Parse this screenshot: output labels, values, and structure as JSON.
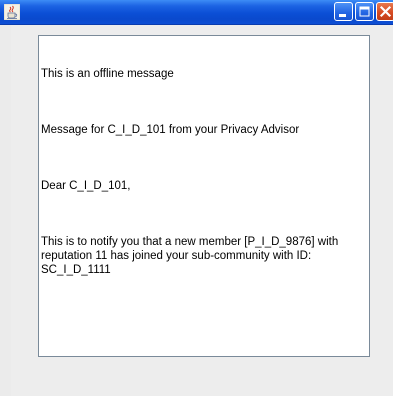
{
  "window": {
    "title": "",
    "icon": "java-coffee-cup-icon",
    "controls": {
      "minimize_icon": "minimize-icon",
      "maximize_icon": "maximize-icon",
      "close_icon": "close-icon"
    },
    "colors": {
      "titlebar": "#0b4fd6",
      "close_button": "#d64b23",
      "background": "#ececec"
    }
  },
  "message": {
    "line1": "This is an offline message",
    "line2": "Message for C_I_D_101 from your Privacy Advisor",
    "line3": "Dear C_I_D_101,",
    "line4": "This is to notify you that a new member [P_I_D_9876] with reputation 11 has joined your sub-community with ID: SC_I_D_1111"
  }
}
